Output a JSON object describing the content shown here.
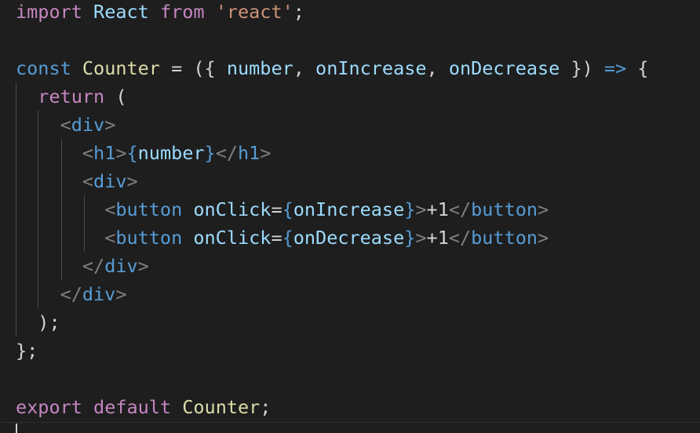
{
  "colors": {
    "background": "#1e1e1e",
    "keyword_control": "#c586c0",
    "keyword_storage": "#569cd6",
    "identifier_type": "#dcdcaa",
    "variable": "#9cdcfe",
    "string": "#ce9178",
    "punctuation": "#d4d4d4",
    "tag": "#569cd6",
    "tag_bracket": "#808080",
    "brace": "#c586c0"
  },
  "code": {
    "line1": [
      {
        "t": "import",
        "c": "#c586c0"
      },
      {
        "t": " "
      },
      {
        "t": "React",
        "c": "#9cdcfe"
      },
      {
        "t": " "
      },
      {
        "t": "from",
        "c": "#c586c0"
      },
      {
        "t": " "
      },
      {
        "t": "'react'",
        "c": "#ce9178"
      },
      {
        "t": ";",
        "c": "#d4d4d4"
      }
    ],
    "line2": [],
    "line3": [
      {
        "t": "const",
        "c": "#569cd6"
      },
      {
        "t": " "
      },
      {
        "t": "Counter",
        "c": "#dcdcaa"
      },
      {
        "t": " = ",
        "c": "#d4d4d4"
      },
      {
        "t": "({ ",
        "c": "#d4d4d4"
      },
      {
        "t": "number",
        "c": "#9cdcfe"
      },
      {
        "t": ", ",
        "c": "#d4d4d4"
      },
      {
        "t": "onIncrease",
        "c": "#9cdcfe"
      },
      {
        "t": ", ",
        "c": "#d4d4d4"
      },
      {
        "t": "onDecrease",
        "c": "#9cdcfe"
      },
      {
        "t": " }) ",
        "c": "#d4d4d4"
      },
      {
        "t": "=>",
        "c": "#569cd6"
      },
      {
        "t": " {",
        "c": "#d4d4d4"
      }
    ],
    "line4": [
      {
        "t": "  "
      },
      {
        "t": "return",
        "c": "#c586c0"
      },
      {
        "t": " (",
        "c": "#d4d4d4"
      }
    ],
    "line5": [
      {
        "t": "    "
      },
      {
        "t": "<",
        "c": "#808080"
      },
      {
        "t": "div",
        "c": "#569cd6"
      },
      {
        "t": ">",
        "c": "#808080"
      }
    ],
    "line6": [
      {
        "t": "      "
      },
      {
        "t": "<",
        "c": "#808080"
      },
      {
        "t": "h1",
        "c": "#569cd6"
      },
      {
        "t": ">",
        "c": "#808080"
      },
      {
        "t": "{",
        "c": "#569cd6"
      },
      {
        "t": "number",
        "c": "#9cdcfe"
      },
      {
        "t": "}",
        "c": "#569cd6"
      },
      {
        "t": "</",
        "c": "#808080"
      },
      {
        "t": "h1",
        "c": "#569cd6"
      },
      {
        "t": ">",
        "c": "#808080"
      }
    ],
    "line7": [
      {
        "t": "      "
      },
      {
        "t": "<",
        "c": "#808080"
      },
      {
        "t": "div",
        "c": "#569cd6"
      },
      {
        "t": ">",
        "c": "#808080"
      }
    ],
    "line8": [
      {
        "t": "        "
      },
      {
        "t": "<",
        "c": "#808080"
      },
      {
        "t": "button",
        "c": "#569cd6"
      },
      {
        "t": " "
      },
      {
        "t": "onClick",
        "c": "#9cdcfe"
      },
      {
        "t": "=",
        "c": "#d4d4d4"
      },
      {
        "t": "{",
        "c": "#569cd6"
      },
      {
        "t": "onIncrease",
        "c": "#9cdcfe"
      },
      {
        "t": "}",
        "c": "#569cd6"
      },
      {
        "t": ">",
        "c": "#808080"
      },
      {
        "t": "+1",
        "c": "#d4d4d4"
      },
      {
        "t": "</",
        "c": "#808080"
      },
      {
        "t": "button",
        "c": "#569cd6"
      },
      {
        "t": ">",
        "c": "#808080"
      }
    ],
    "line9": [
      {
        "t": "        "
      },
      {
        "t": "<",
        "c": "#808080"
      },
      {
        "t": "button",
        "c": "#569cd6"
      },
      {
        "t": " "
      },
      {
        "t": "onClick",
        "c": "#9cdcfe"
      },
      {
        "t": "=",
        "c": "#d4d4d4"
      },
      {
        "t": "{",
        "c": "#569cd6"
      },
      {
        "t": "onDecrease",
        "c": "#9cdcfe"
      },
      {
        "t": "}",
        "c": "#569cd6"
      },
      {
        "t": ">",
        "c": "#808080"
      },
      {
        "t": "+1",
        "c": "#d4d4d4"
      },
      {
        "t": "</",
        "c": "#808080"
      },
      {
        "t": "button",
        "c": "#569cd6"
      },
      {
        "t": ">",
        "c": "#808080"
      }
    ],
    "line10": [
      {
        "t": "      "
      },
      {
        "t": "</",
        "c": "#808080"
      },
      {
        "t": "div",
        "c": "#569cd6"
      },
      {
        "t": ">",
        "c": "#808080"
      }
    ],
    "line11": [
      {
        "t": "    "
      },
      {
        "t": "</",
        "c": "#808080"
      },
      {
        "t": "div",
        "c": "#569cd6"
      },
      {
        "t": ">",
        "c": "#808080"
      }
    ],
    "line12": [
      {
        "t": "  "
      },
      {
        "t": ");",
        "c": "#d4d4d4"
      }
    ],
    "line13": [
      {
        "t": "};",
        "c": "#d4d4d4"
      }
    ],
    "line14": [],
    "line15": [
      {
        "t": "export",
        "c": "#c586c0"
      },
      {
        "t": " "
      },
      {
        "t": "default",
        "c": "#c586c0"
      },
      {
        "t": " "
      },
      {
        "t": "Counter",
        "c": "#dcdcaa"
      },
      {
        "t": ";",
        "c": "#d4d4d4"
      }
    ]
  }
}
